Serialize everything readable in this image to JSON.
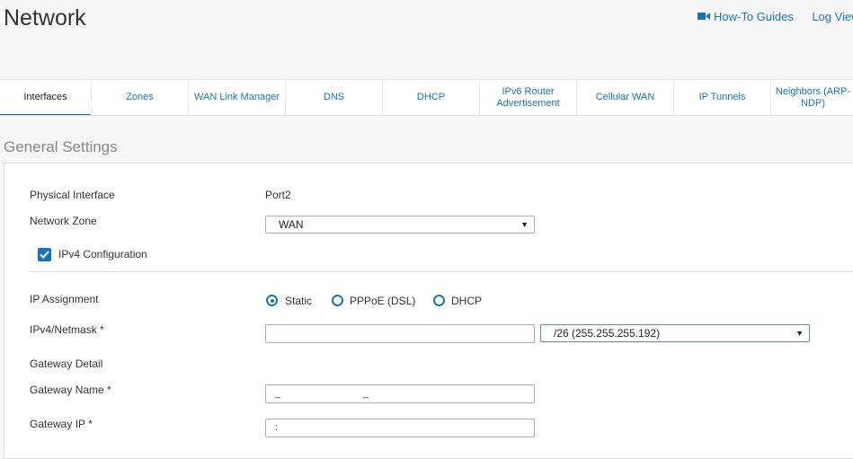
{
  "page": {
    "title": "Network"
  },
  "header_links": {
    "how_to": "How-To Guides",
    "log_viewer": "Log Viewer"
  },
  "tabs": [
    {
      "label": "Interfaces",
      "active": true
    },
    {
      "label": "Zones"
    },
    {
      "label": "WAN Link Manager"
    },
    {
      "label": "DNS"
    },
    {
      "label": "DHCP"
    },
    {
      "label": "IPv6 Router Advertisement"
    },
    {
      "label": "Cellular WAN"
    },
    {
      "label": "IP Tunnels"
    },
    {
      "label": "Neighbors (ARP-NDP)"
    }
  ],
  "section": {
    "title": "General Settings"
  },
  "form": {
    "physical_interface": {
      "label": "Physical Interface",
      "value": "Port2"
    },
    "network_zone": {
      "label": "Network Zone",
      "value": "WAN"
    },
    "ipv4_config": {
      "label": "IPv4 Configuration",
      "checked": true
    },
    "ip_assignment": {
      "label": "IP Assignment",
      "options": [
        "Static",
        "PPPoE (DSL)",
        "DHCP"
      ],
      "selected": "Static"
    },
    "ipv4_netmask": {
      "label": "IPv4/Netmask *",
      "value": "",
      "netmask": "/26 (255.255.255.192)"
    },
    "gateway_detail": {
      "label": "Gateway Detail"
    },
    "gateway_name": {
      "label": "Gateway Name *",
      "value": "_                              _"
    },
    "gateway_ip": {
      "label": "Gateway IP *",
      "value": ":"
    }
  },
  "colors": {
    "accent": "#1a73b5",
    "background": "#f6f6f6"
  },
  "icons": {
    "how_to": "video-camera-icon",
    "checkbox": "checkmark-icon",
    "dropdown": "triangle-down-icon"
  }
}
